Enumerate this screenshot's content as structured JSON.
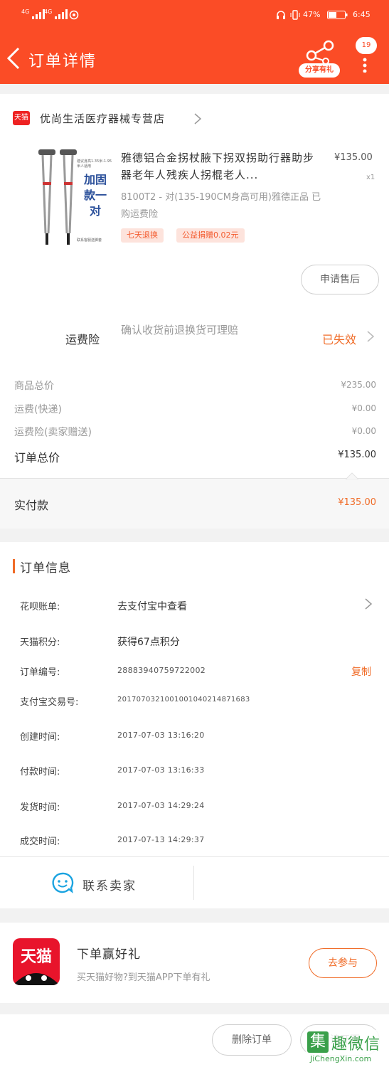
{
  "status": {
    "carrier1": "4G",
    "carrier2": "4G",
    "battery": "47%",
    "time": "6:45"
  },
  "header": {
    "title": "订单详情",
    "share_label": "分享有礼",
    "msg_count": "19"
  },
  "shop": {
    "badge": "天猫",
    "name": "优尚生活医疗器械专营店"
  },
  "product": {
    "title": "雅德铝合金拐杖腋下拐双拐助行器助步器老年人残疾人拐棍老人...",
    "price": "¥135.00",
    "qty": "x1",
    "spec": "8100T2 - 对(135-190CM身高可用)雅德正品 已购运费险",
    "tags": [
      "七天退换",
      "公益捐赠0.02元"
    ],
    "img_text_big": "加固款一对",
    "img_text_small": "建议身高1.35米-1.95米人适用",
    "img_text_bottom": "联系客服送脚套",
    "after_sale": "申请售后"
  },
  "insurance": {
    "label": "运费险",
    "desc": "确认收货前退换货可理赔",
    "status": "已失效"
  },
  "price_summary": {
    "rows": [
      {
        "label": "商品总价",
        "value": "¥235.00"
      },
      {
        "label": "运费(快递)",
        "value": "¥0.00"
      },
      {
        "label": "运费险(卖家赠送)",
        "value": "¥0.00"
      }
    ],
    "total_label": "订单总价",
    "total_value": "¥135.00",
    "paid_label": "实付款",
    "paid_value": "¥135.00"
  },
  "order_info": {
    "title": "订单信息",
    "rows": [
      {
        "label": "花呗账单:",
        "value": "去支付宝中查看"
      },
      {
        "label": "天猫积分:",
        "value": "获得67点积分"
      },
      {
        "label": "订单编号:",
        "value": "28883940759722002",
        "action": "复制"
      },
      {
        "label": "支付宝交易号:",
        "value": "2017070321001001040214871683"
      },
      {
        "label": "创建时间:",
        "value": "2017-07-03 13:16:20"
      },
      {
        "label": "付款时间:",
        "value": "2017-07-03 13:16:33"
      },
      {
        "label": "发货时间:",
        "value": "2017-07-03 14:29:24"
      },
      {
        "label": "成交时间:",
        "value": "2017-07-13 14:29:37"
      }
    ],
    "contact": "联系卖家"
  },
  "promo": {
    "logo": "天猫",
    "title": "下单赢好礼",
    "desc": "买天猫好物?到天猫APP下单有礼",
    "button": "去参与"
  },
  "bottom": {
    "delete": "删除订单",
    "invoice": "申请开票"
  },
  "watermark": {
    "char": "集",
    "text": "趣微信",
    "url": "JiChengXin.com"
  },
  "colors": {
    "accent": "#fb4c26",
    "orange": "#f06b27"
  }
}
